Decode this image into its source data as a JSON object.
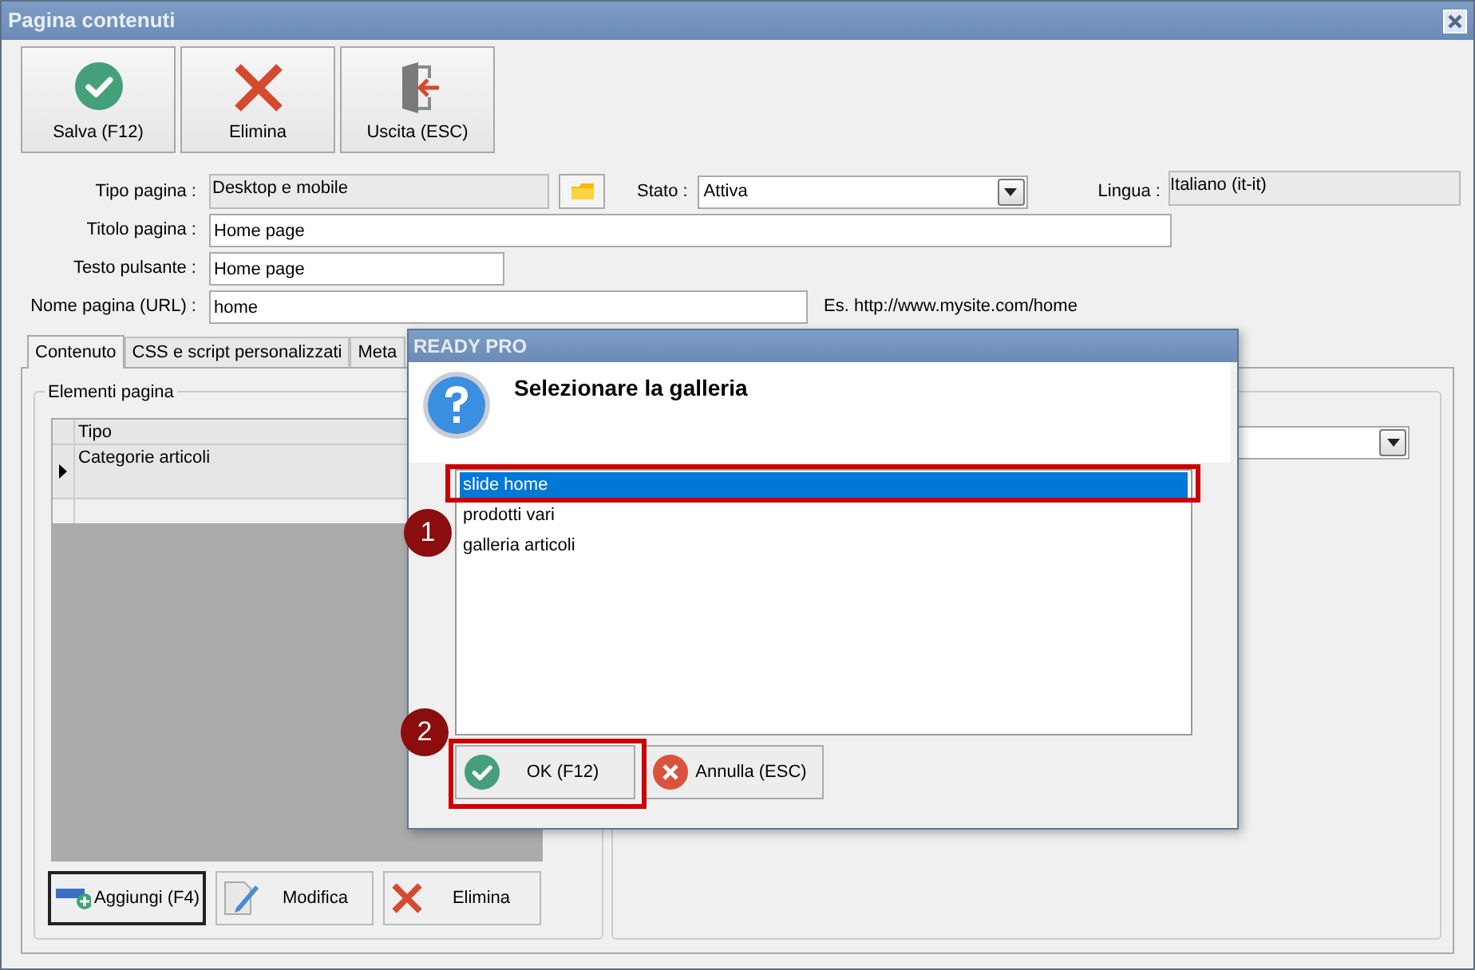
{
  "window": {
    "title": "Pagina contenuti"
  },
  "toolbar": [
    {
      "label": "Salva (F12)",
      "kind": "save"
    },
    {
      "label": "Elimina",
      "kind": "delete"
    },
    {
      "label": "Uscita (ESC)",
      "kind": "exit"
    }
  ],
  "form": {
    "tipo_pagina": {
      "label": "Tipo pagina :",
      "value": "Desktop e mobile"
    },
    "stato": {
      "label": "Stato :",
      "value": "Attiva"
    },
    "lingua": {
      "label": "Lingua :",
      "value": "Italiano (it-it)"
    },
    "titolo_pagina": {
      "label": "Titolo pagina :",
      "value": "Home page"
    },
    "testo_pulsante": {
      "label": "Testo pulsante :",
      "value": "Home page"
    },
    "nome_pagina": {
      "label": "Nome pagina (URL) :",
      "value": "home",
      "hint": "Es. http://www.mysite.com/home"
    }
  },
  "tabs": [
    {
      "label": "Contenuto",
      "selected": true
    },
    {
      "label": "CSS e script personalizzati",
      "selected": false
    },
    {
      "label": "Meta",
      "selected": false
    }
  ],
  "page_elements": {
    "title": "Elementi pagina",
    "columns": [
      "Tipo"
    ],
    "rows": [
      {
        "cells": [
          "Categorie articoli"
        ],
        "current": true
      }
    ],
    "buttons": [
      {
        "label": "Aggiungi (F4)",
        "kind": "add",
        "focused": true
      },
      {
        "label": "Modifica",
        "kind": "edit",
        "focused": false
      },
      {
        "label": "Elimina",
        "kind": "delete",
        "focused": false
      }
    ]
  },
  "dialog": {
    "title": "READY PRO",
    "message": "Selezionare la galleria",
    "items": [
      {
        "label": "slide home",
        "selected": true
      },
      {
        "label": "prodotti vari",
        "selected": false
      },
      {
        "label": "galleria articoli",
        "selected": false
      }
    ],
    "buttons": [
      {
        "label": "OK (F12)",
        "kind": "ok"
      },
      {
        "label": "Annulla (ESC)",
        "kind": "cancel"
      }
    ]
  },
  "annotations": [
    {
      "label": "1"
    },
    {
      "label": "2"
    }
  ]
}
